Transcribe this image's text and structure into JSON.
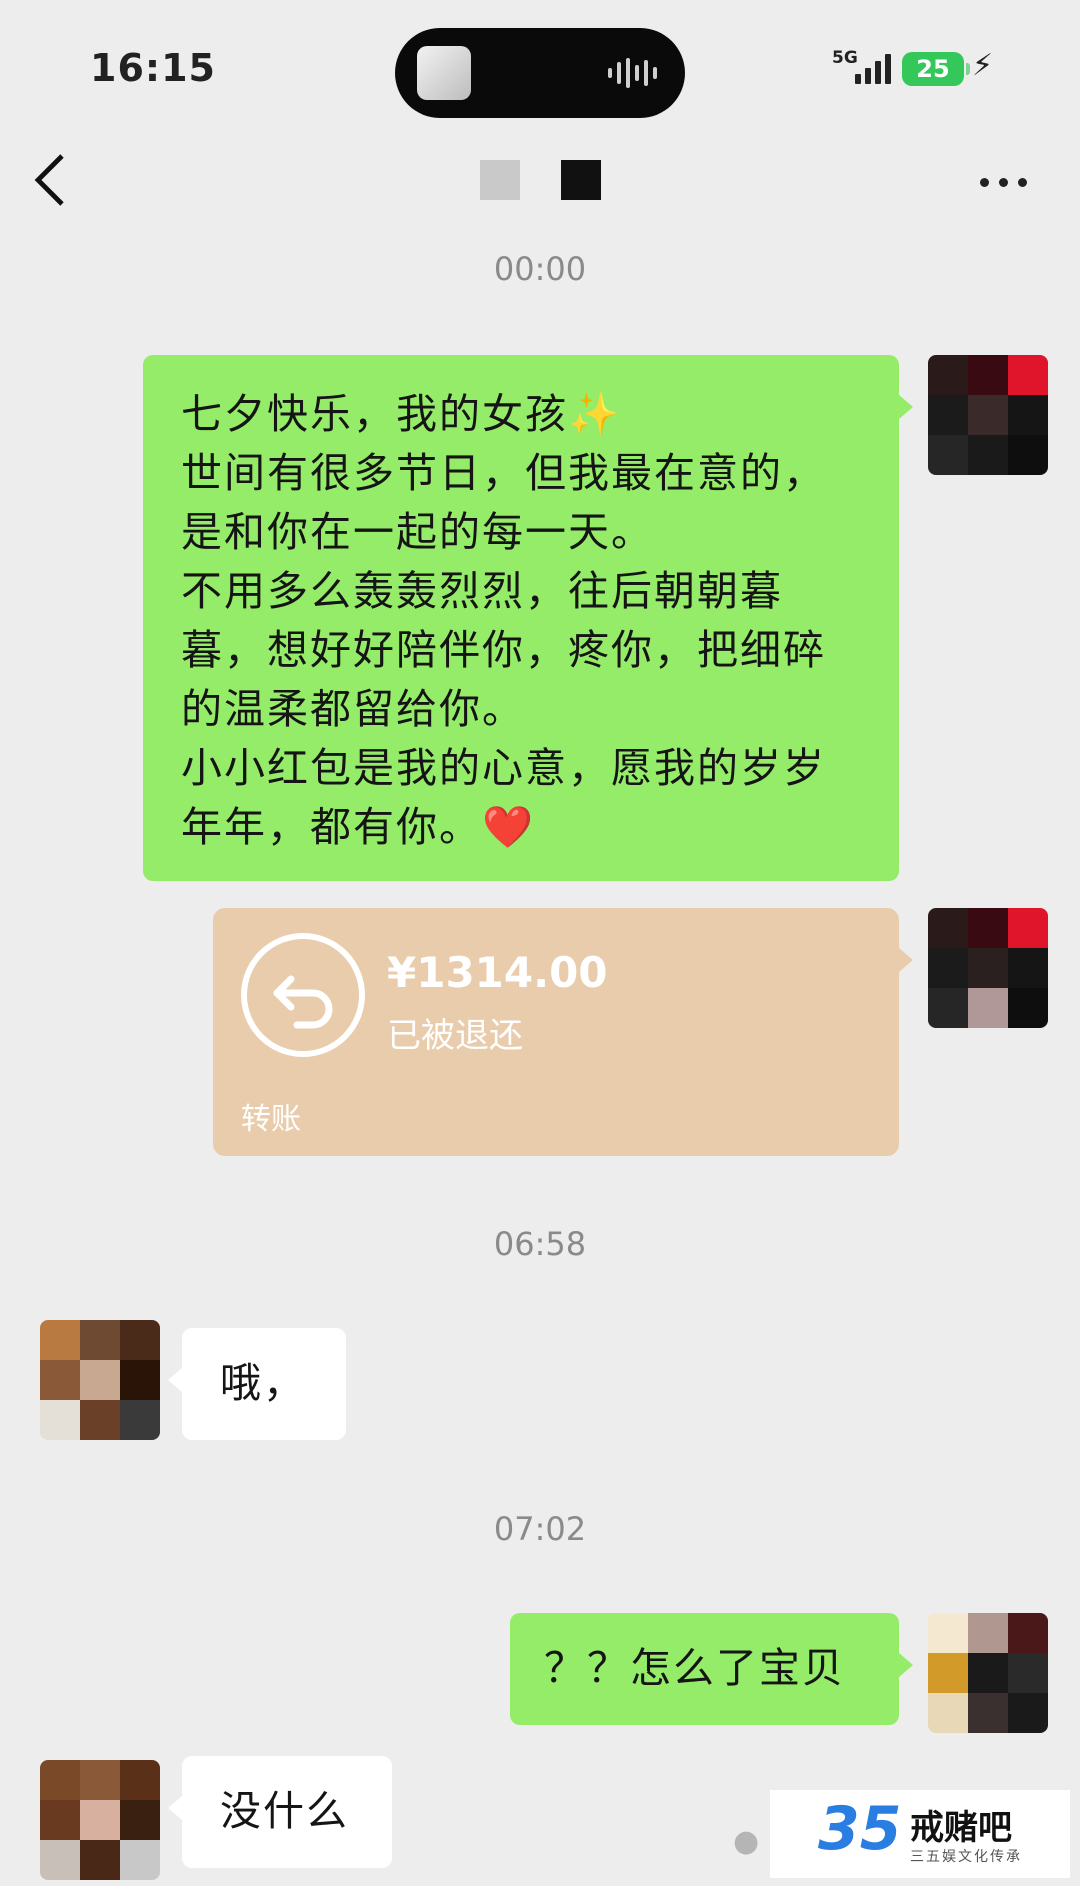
{
  "status_bar": {
    "time": "16:15",
    "network": "5G",
    "battery": "25"
  },
  "nav": {
    "back_icon": "chevron-left-icon",
    "more_icon": "more-dots-icon"
  },
  "messages": {
    "stamp1": "00:00",
    "msg1": "七夕快乐，我的女孩✨\n世间有很多节日，但我最在意的，\n是和你在一起的每一天。\n不用多么轰轰烈烈，往后朝朝暮\n暮，想好好陪伴你，疼你，把细碎\n的温柔都留给你。\n小小红包是我的心意，愿我的岁岁\n年年，都有你。❤️",
    "transfer": {
      "amount": "¥1314.00",
      "status": "已被退还",
      "label": "转账"
    },
    "stamp2": "06:58",
    "msg2": "哦，",
    "stamp3": "07:02",
    "msg3": "？？怎么了宝贝",
    "msg4": "没什么"
  },
  "watermark": {
    "logo": "35",
    "name": "戒赌吧",
    "sub": "三五娱文化传承",
    "wechat_icon": "wechat-icon"
  },
  "colors": {
    "background": "#ededed",
    "sent_bubble": "#95ec69",
    "received_bubble": "#ffffff",
    "transfer_card": "#e8ccab"
  }
}
